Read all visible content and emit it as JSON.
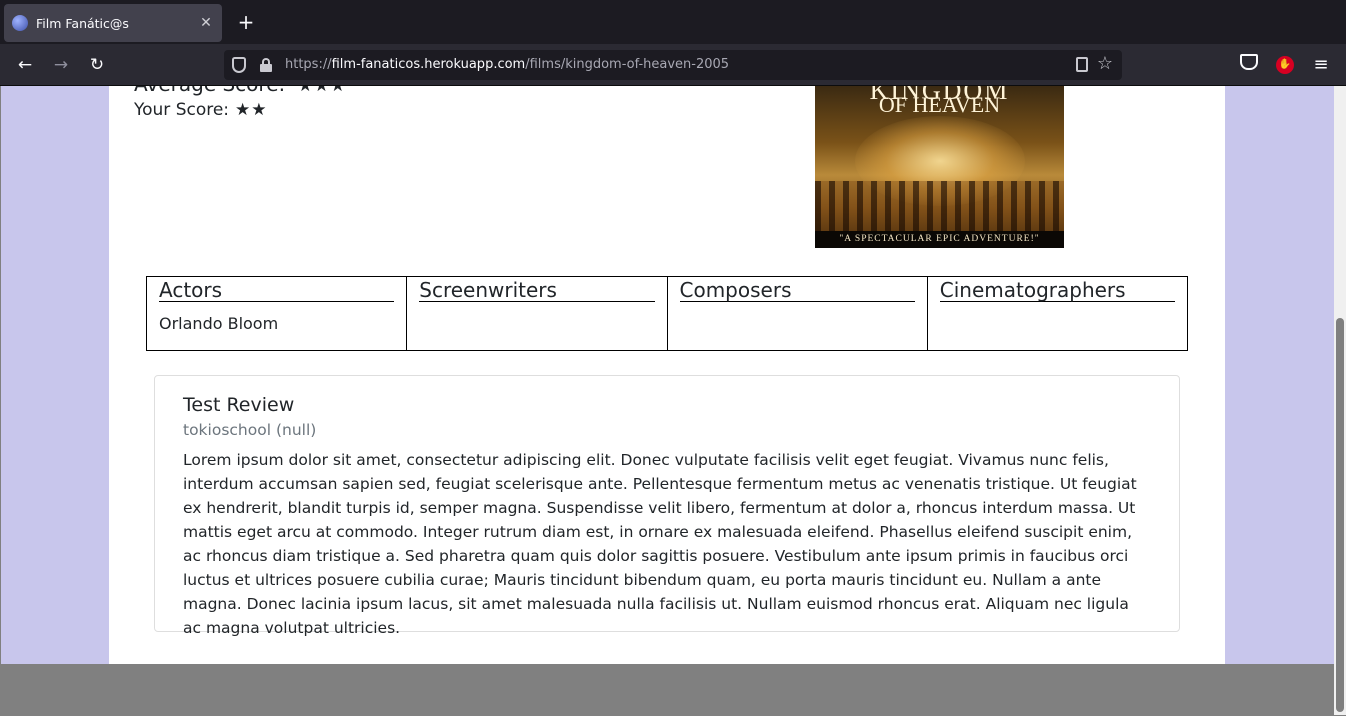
{
  "browser": {
    "tab_title": "Film Fanátic@s",
    "tab_close": "✕",
    "new_tab": "+",
    "url_scheme": "https://",
    "url_host": "film-fanaticos.herokuapp.com",
    "url_path": "/films/kingdom-of-heaven-2005",
    "back": "←",
    "forward": "→",
    "reload": "↻",
    "bookmark": "☆",
    "menu": "≡"
  },
  "film": {
    "average_score_label": "Average Score:",
    "average_stars": "★★★",
    "your_score_label": "Your Score:",
    "your_stars": "★★",
    "poster": {
      "title_line1": "KINGDOM",
      "title_line2": "OF HEAVEN",
      "tagline": "\"A SPECTACULAR EPIC ADVENTURE!\""
    }
  },
  "crew": [
    {
      "heading": "Actors",
      "items": [
        "Orlando Bloom"
      ]
    },
    {
      "heading": "Screenwriters",
      "items": []
    },
    {
      "heading": "Composers",
      "items": []
    },
    {
      "heading": "Cinematographers",
      "items": []
    }
  ],
  "review": {
    "title": "Test Review",
    "author": "tokioschool (null)",
    "body": "Lorem ipsum dolor sit amet, consectetur adipiscing elit. Donec vulputate facilisis velit eget feugiat. Vivamus nunc felis, interdum accumsan sapien sed, feugiat scelerisque ante. Pellentesque fermentum metus ac venenatis tristique. Ut feugiat ex hendrerit, blandit turpis id, semper magna. Suspendisse velit libero, fermentum at dolor a, rhoncus interdum massa. Ut mattis eget arcu at commodo. Integer rutrum diam est, in ornare ex malesuada eleifend. Phasellus eleifend suscipit enim, ac rhoncus diam tristique a. Sed pharetra quam quis dolor sagittis posuere. Vestibulum ante ipsum primis in faucibus orci luctus et ultrices posuere cubilia curae; Mauris tincidunt bibendum quam, eu porta mauris tincidunt eu. Nullam a ante magna. Donec lacinia ipsum lacus, sit amet malesuada nulla facilisis ut. Nullam euismod rhoncus erat. Aliquam nec ligula ac magna volutpat ultricies."
  },
  "colors": {
    "page_background": "#c8c6ec",
    "card_background": "#ffffff",
    "muted_text": "#6c757d"
  }
}
